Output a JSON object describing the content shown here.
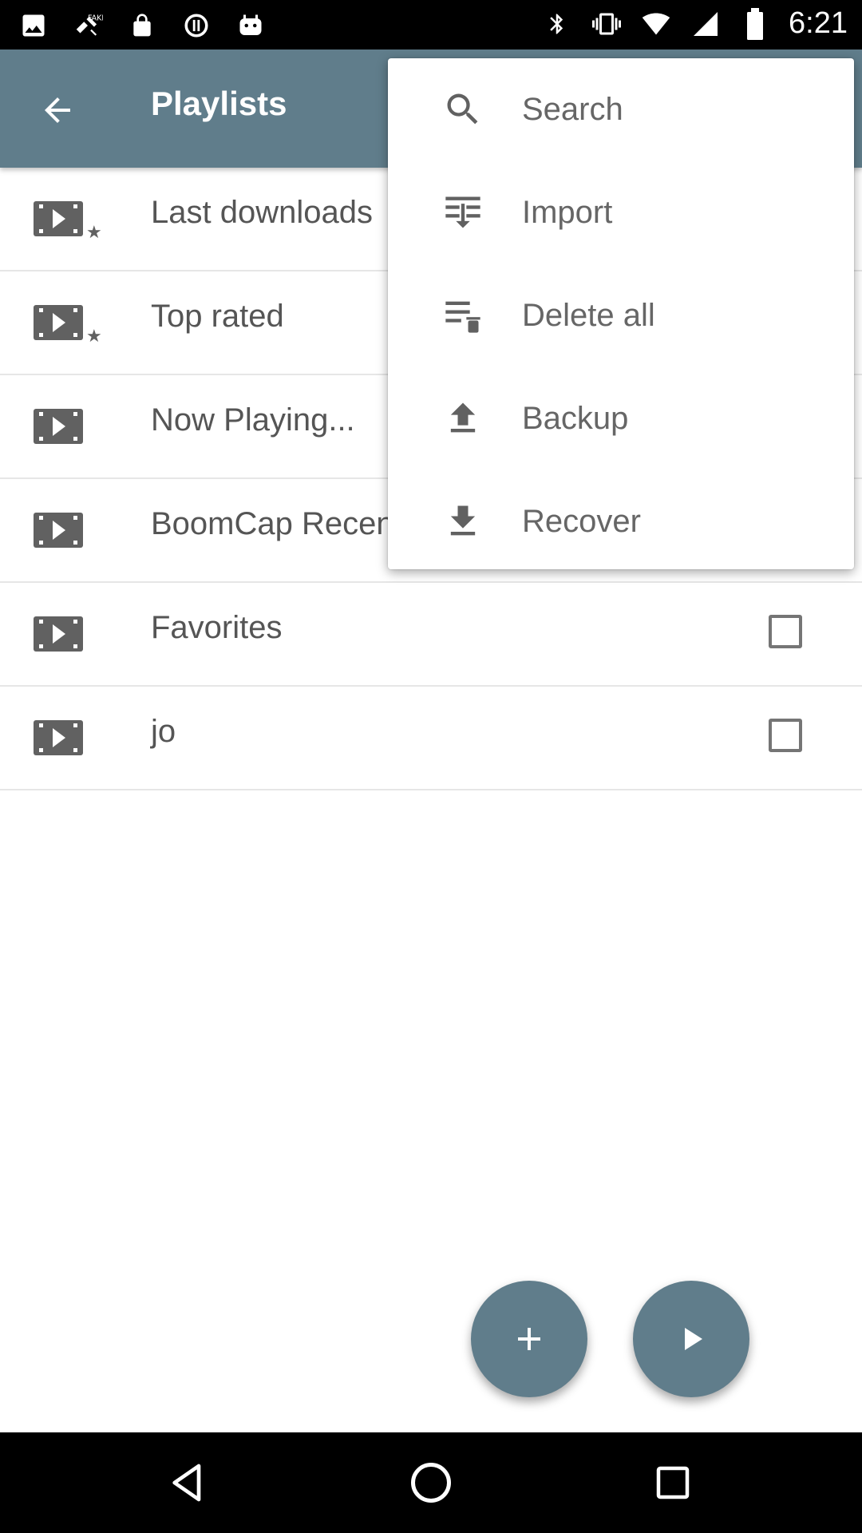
{
  "status_bar": {
    "time": "6:21",
    "left_icons": [
      "picture-icon",
      "fake-gps-icon",
      "lock-icon",
      "sync-icon",
      "android-icon"
    ],
    "right_icons": [
      "bluetooth-icon",
      "vibrate-icon",
      "wifi-icon",
      "signal-icon",
      "battery-icon"
    ]
  },
  "app_bar": {
    "title": "Playlists",
    "back_icon": "arrow-back-icon"
  },
  "playlists": [
    {
      "label": "Last downloads",
      "icon": "video-star-icon",
      "has_checkbox": false
    },
    {
      "label": "Top rated",
      "icon": "video-star-icon",
      "has_checkbox": false
    },
    {
      "label": "Now Playing...",
      "icon": "video-icon",
      "has_checkbox": false
    },
    {
      "label": "BoomCap Recen",
      "icon": "video-icon",
      "has_checkbox": false
    },
    {
      "label": "Favorites",
      "icon": "video-icon",
      "has_checkbox": true,
      "checked": false
    },
    {
      "label": "jo",
      "icon": "video-icon",
      "has_checkbox": true,
      "checked": false
    }
  ],
  "menu": {
    "items": [
      {
        "label": "Search",
        "icon": "search-icon"
      },
      {
        "label": "Import",
        "icon": "import-icon"
      },
      {
        "label": "Delete all",
        "icon": "delete-all-icon"
      },
      {
        "label": "Backup",
        "icon": "upload-icon"
      },
      {
        "label": "Recover",
        "icon": "download-icon"
      }
    ]
  },
  "fabs": {
    "add_icon": "plus-icon",
    "play_icon": "play-icon"
  },
  "colors": {
    "primary": "#607d8b",
    "icon_gray": "#616161",
    "text_gray": "#555555"
  }
}
